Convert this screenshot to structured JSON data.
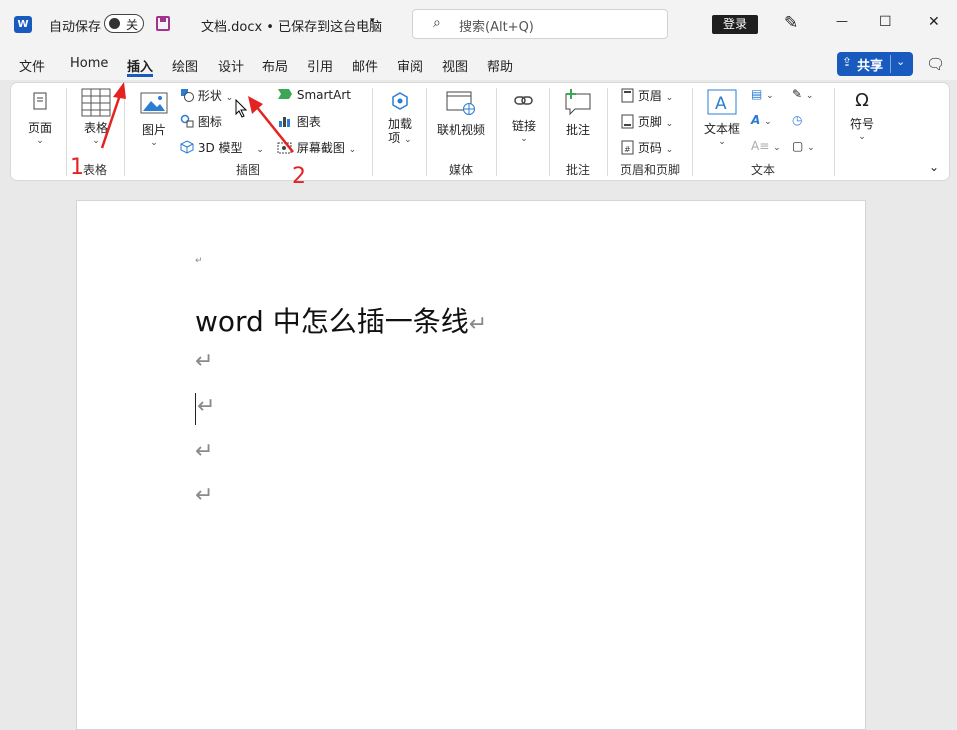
{
  "titlebar": {
    "app_icon": "word-icon",
    "autosave_label": "自动保存",
    "autosave_state": "关",
    "doc_title": "文档.docx • 已保存到这台电脑",
    "search_placeholder": "搜索(Alt+Q)",
    "login_label": "登录",
    "minimize": "—",
    "maximize": "☐",
    "close": "✕"
  },
  "menubar": {
    "items": [
      "文件",
      "Home",
      "插入",
      "绘图",
      "设计",
      "布局",
      "引用",
      "邮件",
      "审阅",
      "视图",
      "帮助"
    ],
    "active": "插入",
    "share_label": "共享"
  },
  "ribbon": {
    "pages": {
      "label": "页面"
    },
    "tables": {
      "label": "表格",
      "group": "表格"
    },
    "illustrations": {
      "pictures": "图片",
      "shapes": "形状",
      "icons": "图标",
      "models3d": "3D 模型",
      "smartart": "SmartArt",
      "chart": "图表",
      "screenshot": "屏幕截图",
      "group": "插图"
    },
    "addins": {
      "label1": "加载",
      "label2": "项"
    },
    "media": {
      "label": "联机视频",
      "group": "媒体"
    },
    "links": {
      "label": "链接"
    },
    "comments": {
      "label": "批注",
      "group": "批注"
    },
    "header_footer": {
      "header": "页眉",
      "footer": "页脚",
      "page_number": "页码",
      "group": "页眉和页脚"
    },
    "text": {
      "textbox": "文本框",
      "group": "文本"
    },
    "symbols": {
      "label": "符号"
    }
  },
  "document": {
    "heading": "word 中怎么插一条线",
    "paragraph_mark": "↵"
  },
  "annotations": {
    "step1": "1",
    "step2": "2"
  },
  "colors": {
    "accent": "#185abd",
    "annotation": "#e52222"
  }
}
